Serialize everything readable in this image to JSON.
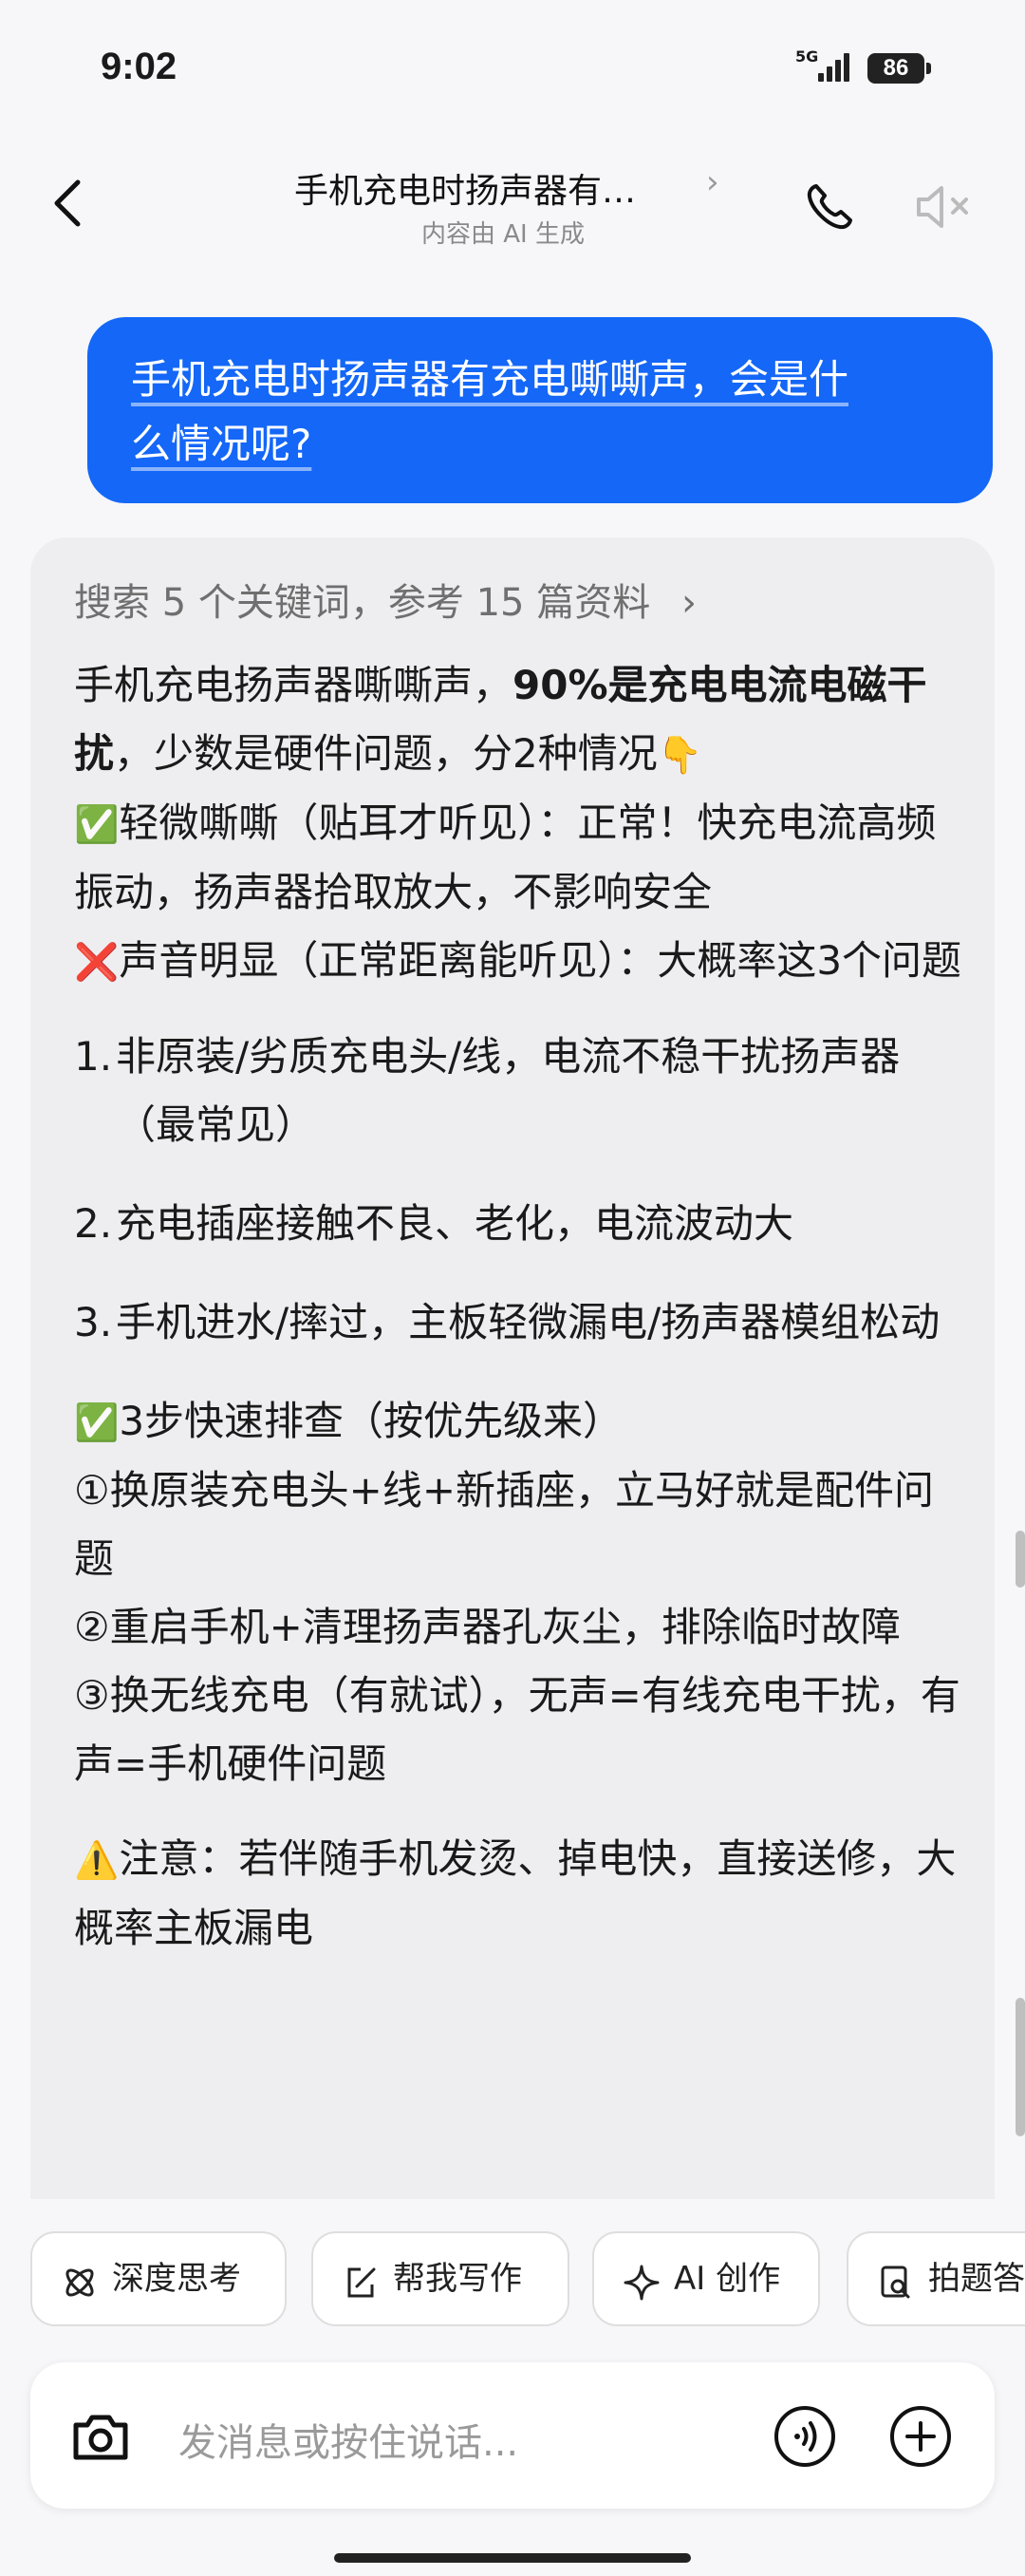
{
  "status_bar": {
    "time": "9:02",
    "network": "5G",
    "battery": "86"
  },
  "header": {
    "title": "手机充电时扬声器有…",
    "chevron": "›",
    "subtitle": "内容由 AI 生成"
  },
  "user_message": {
    "line1": "手机充电时扬声器有充电嘶嘶声，会是什",
    "line2": "么情况呢?"
  },
  "ai_answer": {
    "search_summary": "搜索 5 个关键词，参考 15 篇资料",
    "search_chevron": "›",
    "intro_a": "手机充电扬声器嘶嘶声，",
    "intro_bold": "90%是充电电流电磁干扰",
    "intro_b": "，少数是硬件问题，分2种情况",
    "intro_emoji": "👇",
    "normal_emoji": "✅",
    "normal_text": "轻微嘶嘶（贴耳才听见）：正常！快充电流高频振动，扬声器拾取放大，不影响安全",
    "issue_emoji": "❌",
    "issue_text": "声音明显（正常距离能听见）：大概率这3个问题",
    "causes": [
      {
        "num": "1.",
        "text": "非原装/劣质充电头/线，电流不稳干扰扬声器（最常见）"
      },
      {
        "num": "2.",
        "text": "充电插座接触不良、老化，电流波动大"
      },
      {
        "num": "3.",
        "text": "手机进水/摔过，主板轻微漏电/扬声器模组松动"
      }
    ],
    "steps_emoji": "✅",
    "steps_title": "3步快速排查（按优先级来）",
    "steps": [
      "①换原装充电头+线+新插座，立马好就是配件问题",
      "②重启手机+清理扬声器孔灰尘，排除临时故障",
      "③换无线充电（有就试），无声=有线充电干扰，有声=手机硬件问题"
    ],
    "warning_emoji": "⚠️",
    "warning_text": "注意：若伴随手机发烫、掉电快，直接送修，大概率主板漏电"
  },
  "chips": [
    "深度思考",
    "帮我写作",
    "AI 创作",
    "拍题答疑"
  ],
  "input": {
    "placeholder": "发消息或按住说话..."
  },
  "colors": {
    "accent": "#1467f7",
    "card": "#eeeef0",
    "background": "#f7f7f9"
  }
}
